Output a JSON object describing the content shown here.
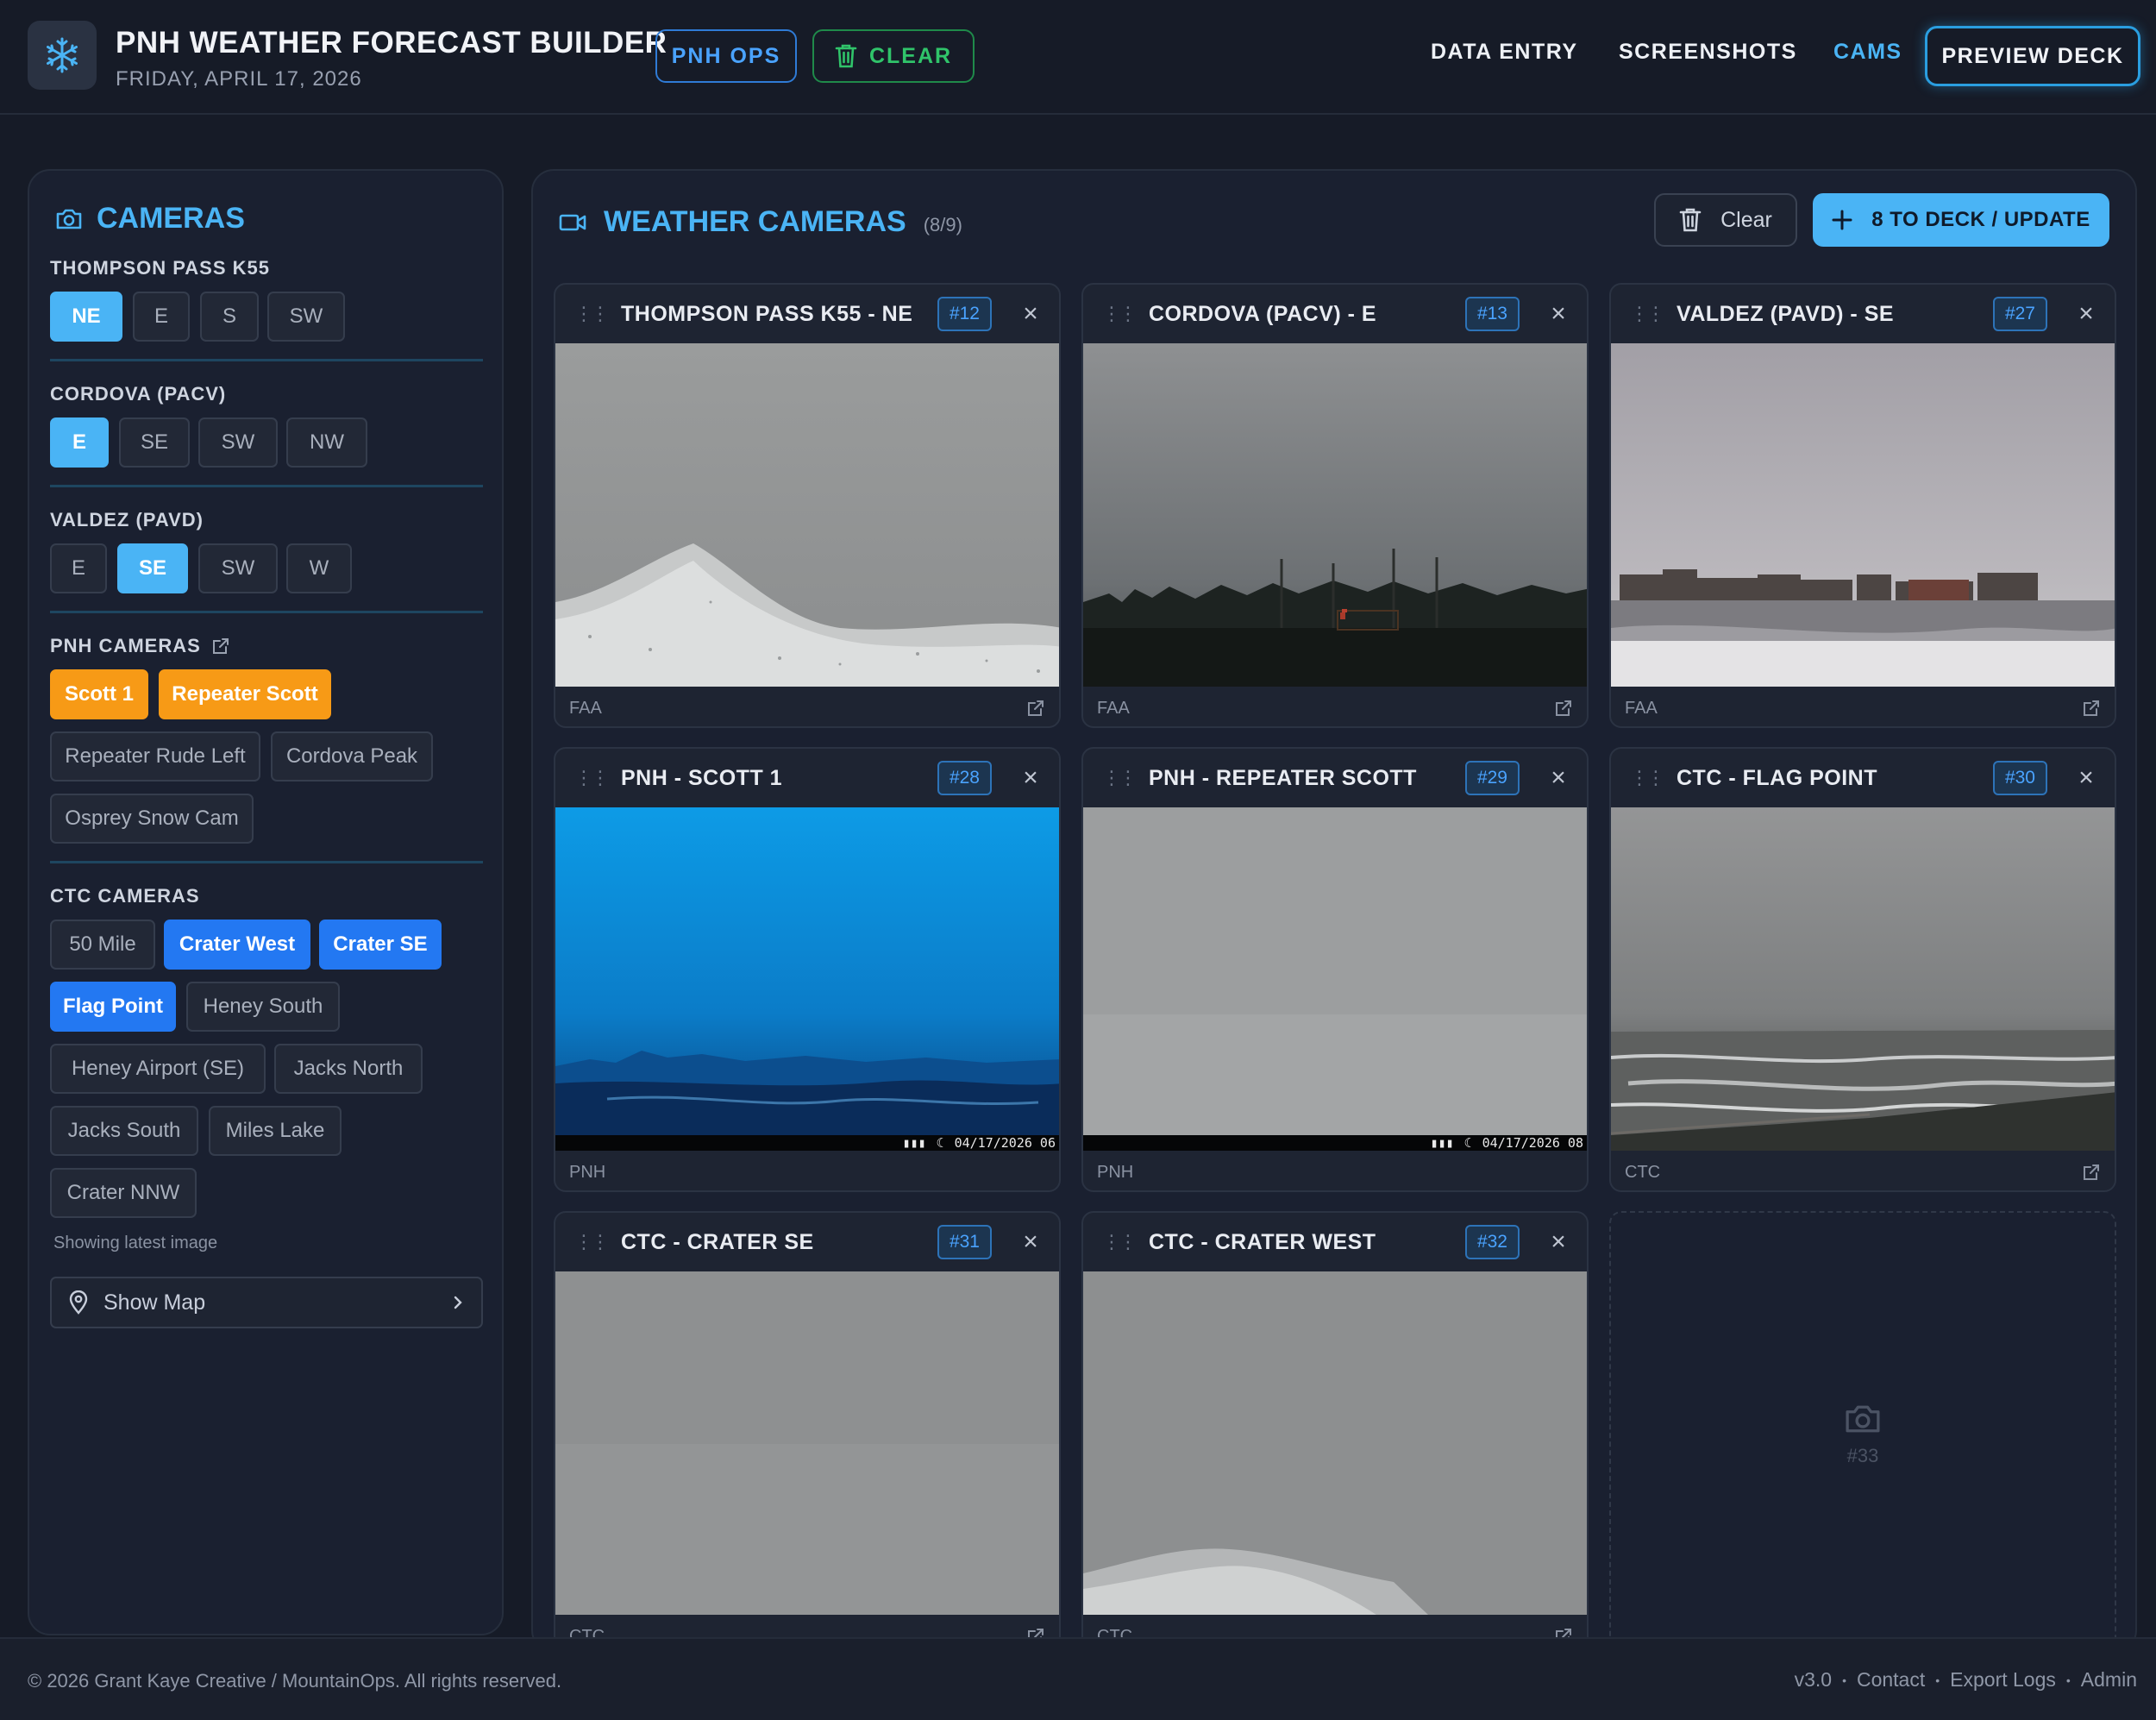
{
  "header": {
    "title": "PNH WEATHER FORECAST BUILDER",
    "date": "FRIDAY, APRIL 17, 2026",
    "ops_label": "PNH OPS",
    "clear_label": "CLEAR",
    "nav": [
      "DATA ENTRY",
      "SCREENSHOTS",
      "CAMS"
    ],
    "active_nav": "CAMS",
    "preview_label": "PREVIEW DECK"
  },
  "sidebar": {
    "title": "CAMERAS",
    "groups": [
      {
        "label": "THOMPSON PASS K55",
        "options": [
          "NE",
          "E",
          "S",
          "SW"
        ],
        "selected": [
          "NE"
        ]
      },
      {
        "label": "CORDOVA (PACV)",
        "options": [
          "E",
          "SE",
          "SW",
          "NW"
        ],
        "selected": [
          "E"
        ]
      },
      {
        "label": "VALDEZ (PAVD)",
        "options": [
          "E",
          "SE",
          "SW",
          "W"
        ],
        "selected": [
          "SE"
        ]
      },
      {
        "label": "PNH CAMERAS",
        "options": [
          "Scott 1",
          "Repeater Scott",
          "Repeater Rude Left",
          "Cordova Peak",
          "Osprey Snow Cam"
        ],
        "selected": [
          "Scott 1",
          "Repeater Scott"
        ]
      },
      {
        "label": "CTC CAMERAS",
        "options": [
          "50 Mile",
          "Crater West",
          "Crater SE",
          "Flag Point",
          "Heney South",
          "Heney Airport (SE)",
          "Jacks North",
          "Jacks South",
          "Miles Lake",
          "Crater NNW"
        ],
        "selected": [
          "Crater West",
          "Crater SE",
          "Flag Point"
        ]
      }
    ],
    "status_note": "Showing latest image",
    "show_map_label": "Show Map"
  },
  "main": {
    "title": "WEATHER CAMERAS",
    "count": "(8/9)",
    "clear_label": "Clear",
    "deck_label": "8 TO DECK / UPDATE",
    "cams": [
      {
        "title": "THOMPSON PASS K55 - NE",
        "num": "#12",
        "source": "FAA"
      },
      {
        "title": "CORDOVA (PACV) - E",
        "num": "#13",
        "source": "FAA"
      },
      {
        "title": "VALDEZ (PAVD) - SE",
        "num": "#27",
        "source": "FAA"
      },
      {
        "title": "PNH - SCOTT 1",
        "num": "#28",
        "source": "PNH",
        "stamp": "04/17/2026 06"
      },
      {
        "title": "PNH - REPEATER SCOTT",
        "num": "#29",
        "source": "PNH",
        "stamp": "04/17/2026 08"
      },
      {
        "title": "CTC - FLAG POINT",
        "num": "#30",
        "source": "CTC"
      },
      {
        "title": "CTC - CRATER SE",
        "num": "#31",
        "source": "CTC"
      },
      {
        "title": "CTC - CRATER WEST",
        "num": "#32",
        "source": "CTC"
      }
    ],
    "empty_slot": "#33"
  },
  "footer": {
    "copyright": "© 2026 Grant Kaye Creative / MountainOps. All rights reserved.",
    "version": "v3.0",
    "links": [
      "Contact",
      "Export Logs",
      "Admin"
    ]
  },
  "colors": {
    "background": "#161b27",
    "accent": "#4ab4f5",
    "pnh_selected": "#f79a16",
    "ctc_selected": "#2378f2",
    "ops_blue": "#4aa3ff",
    "clear_green": "#30c46a"
  }
}
